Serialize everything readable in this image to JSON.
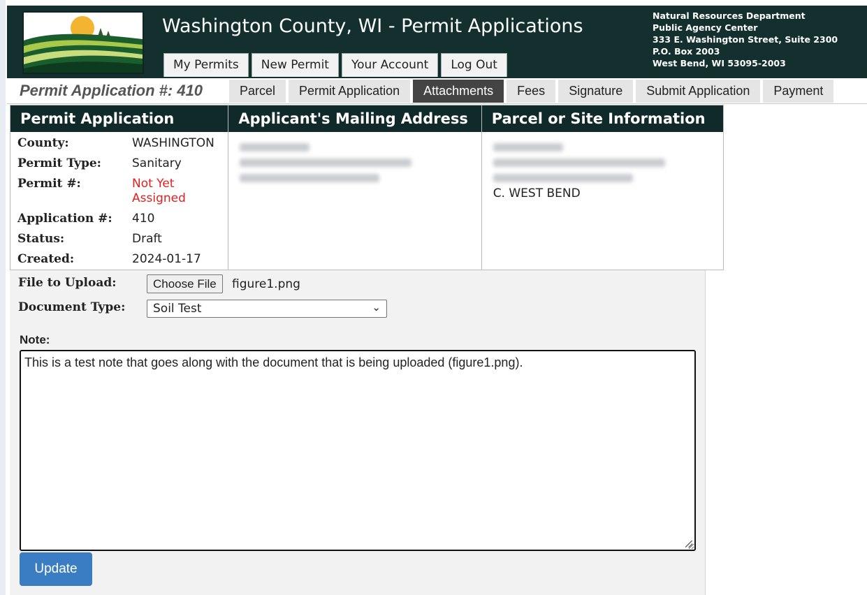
{
  "header": {
    "title": "Washington County, WI - Permit Applications",
    "nav_tabs": [
      "My Permits",
      "New Permit",
      "Your Account",
      "Log Out"
    ],
    "department": {
      "line1": "Natural Resources Department",
      "line2": "Public Agency Center",
      "line3": "333 E. Washington Street, Suite 2300",
      "line4": "P.O. Box 2003",
      "line5": "West Bend, WI 53095-2003"
    }
  },
  "subnav": {
    "app_label": "Permit Application #: 410",
    "tabs": [
      "Parcel",
      "Permit Application",
      "Attachments",
      "Fees",
      "Signature",
      "Submit Application",
      "Payment"
    ],
    "active_tab": "Attachments"
  },
  "panels": {
    "permit": {
      "heading": "Permit Application",
      "rows": [
        {
          "label": "County:",
          "value": "WASHINGTON"
        },
        {
          "label": "Permit Type:",
          "value": "Sanitary"
        },
        {
          "label": "Permit #:",
          "value": "Not Yet Assigned"
        },
        {
          "label": "Application #:",
          "value": "410"
        },
        {
          "label": "Status:",
          "value": "Draft"
        },
        {
          "label": "Created:",
          "value": "2024-01-17"
        }
      ]
    },
    "mailing": {
      "heading": "Applicant's Mailing Address"
    },
    "site": {
      "heading": "Parcel or Site Information",
      "city": "C. WEST BEND"
    }
  },
  "form": {
    "file_label": "File to Upload:",
    "choose_button": "Choose File",
    "file_name": "figure1.png",
    "doctype_label": "Document Type:",
    "doctype_value": "Soil Test",
    "note_label": "Note:",
    "note_text": "This is a test note that goes along with the document that is being uploaded (figure1.png).",
    "update_button": "Update"
  },
  "colors": {
    "header_bg": "#13302e",
    "active_tab": "#444444",
    "update_button": "#3b7dc2",
    "not_assigned": "#e02020"
  }
}
